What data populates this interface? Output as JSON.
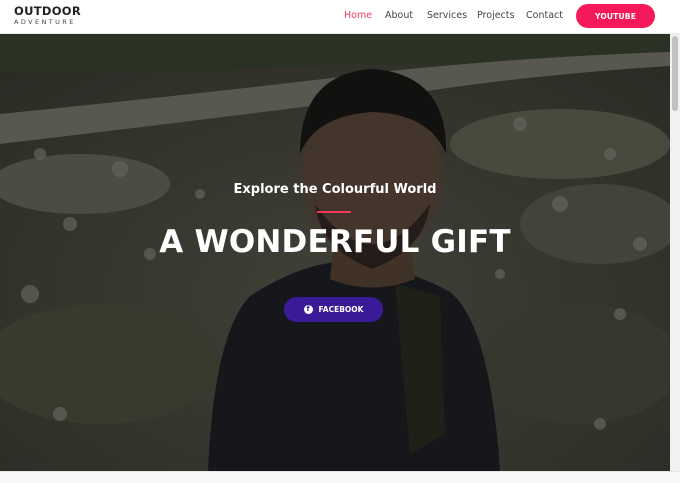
{
  "brand": {
    "title": "OUTDOOR",
    "subtitle": "ADVENTURE"
  },
  "nav": {
    "items": [
      {
        "label": "Home",
        "active": true
      },
      {
        "label": "About",
        "active": false
      },
      {
        "label": "Services",
        "active": false
      },
      {
        "label": "Projects",
        "active": false
      },
      {
        "label": "Contact",
        "active": false
      }
    ],
    "cta_label": "YOUTUBE"
  },
  "hero": {
    "subtitle": "Explore the Colourful World",
    "title": "A WONDERFUL GIFT",
    "button_label": "FACEBOOK",
    "button_icon": "facebook-icon"
  },
  "colors": {
    "accent": "#f0385f",
    "cta": "#f5195a",
    "button": "#3a1a96"
  }
}
